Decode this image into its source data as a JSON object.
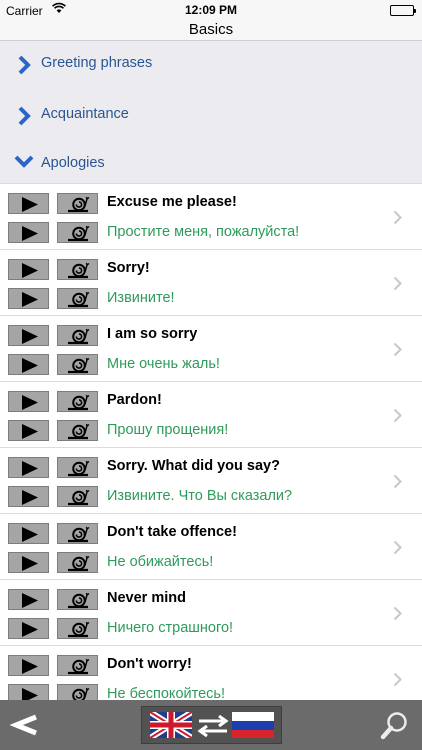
{
  "status": {
    "carrier": "Carrier",
    "time": "12:09 PM"
  },
  "nav": {
    "title": "Basics"
  },
  "categories": [
    {
      "label": "Greeting phrases",
      "state": "collapsed"
    },
    {
      "label": "Acquaintance",
      "state": "collapsed"
    },
    {
      "label": "Apologies",
      "state": "expanded"
    }
  ],
  "phrases": [
    {
      "en": "Excuse me please!",
      "ru": "Простите меня, пожалуйста!"
    },
    {
      "en": "Sorry!",
      "ru": "Извините!"
    },
    {
      "en": "I am so sorry",
      "ru": "Мне очень жаль!"
    },
    {
      "en": "Pardon!",
      "ru": "Прошу прощения!"
    },
    {
      "en": "Sorry. What did you say?",
      "ru": "Извините. Что Вы сказали?"
    },
    {
      "en": "Don't take offence!",
      "ru": "Не обижайтесь!"
    },
    {
      "en": "Never mind",
      "ru": "Ничего страшного!"
    },
    {
      "en": "Don't worry!",
      "ru": "Не беспокойтесь!"
    }
  ],
  "colors": {
    "accent": "#2a5592",
    "russian_text": "#2f9a5b",
    "bottom_bar": "#6b6b6b"
  },
  "icons": {
    "play": "play-icon",
    "slow_play": "snail-icon",
    "disclosure": "chevron-right-icon",
    "back": "back-arrow-icon",
    "search": "magnifier-icon",
    "flag_from": "uk-flag-icon",
    "flag_to": "russia-flag-icon"
  }
}
